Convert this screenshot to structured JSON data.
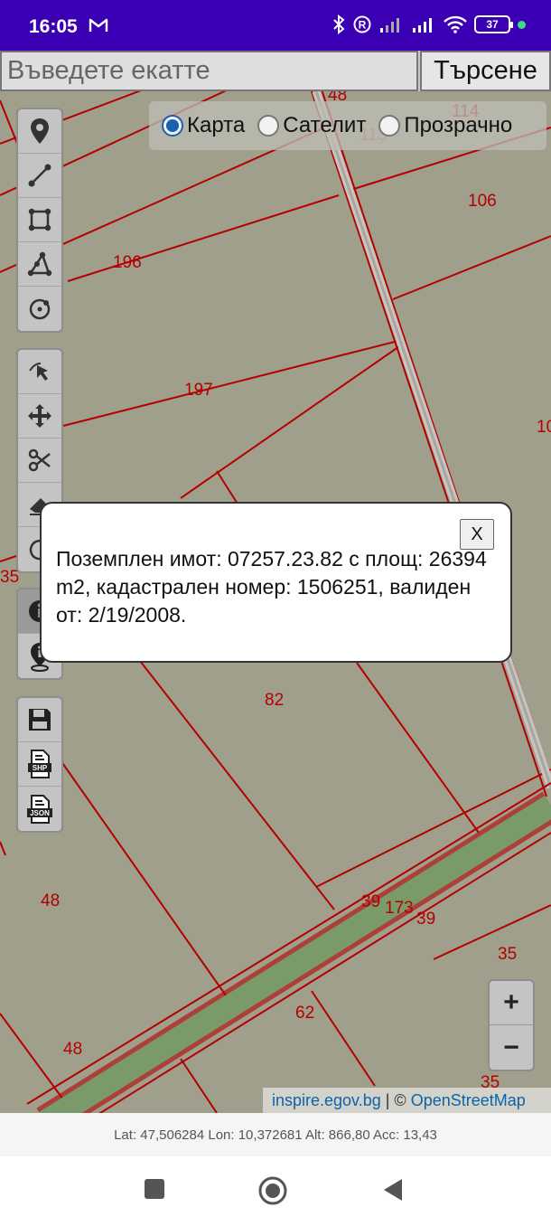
{
  "status_bar": {
    "time": "16:05",
    "battery_level": "37"
  },
  "search": {
    "placeholder": "Въведете екатте",
    "value": "",
    "button_label": "Търсене"
  },
  "layers": [
    {
      "label": "Карта",
      "selected": true
    },
    {
      "label": "Сателит",
      "selected": false
    },
    {
      "label": "Прозрачно",
      "selected": false
    }
  ],
  "parcel_labels": [
    "48",
    "114",
    "113",
    "106",
    "196",
    "197",
    "10",
    "35",
    "82",
    "48",
    "39",
    "173",
    "39",
    "35",
    "62",
    "48",
    "35"
  ],
  "popup": {
    "text": "Поземплен имот: 07257.23.82 с площ: 26394 m2, кадастрален номер: 1506251, валиден от: 2/19/2008.",
    "close_label": "X"
  },
  "zoom": {
    "in_label": "+",
    "out_label": "−"
  },
  "attribution": {
    "link1": "inspire.egov.bg",
    "separator": " | © ",
    "link2": "OpenStreetMap"
  },
  "coords": {
    "text": "Lat: 47,506284 Lon: 10,372681 Alt: 866,80 Acc: 13,43"
  },
  "colors": {
    "status_bar": "#3b00b3",
    "map_bg": "#a09f8c",
    "parcel_line": "#b40000",
    "road": "#7a9a6a"
  }
}
